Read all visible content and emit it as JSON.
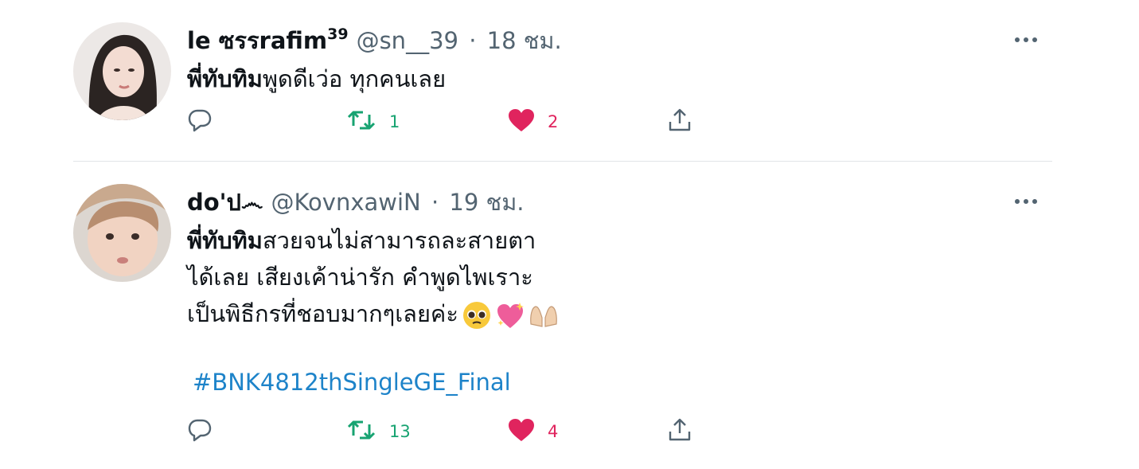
{
  "tweets": [
    {
      "display_name": "le ซรรrafim",
      "name_superscript": "39",
      "handle": "@sn__39",
      "separator": "·",
      "time": "18 ชม.",
      "text_bold": "พี่ทับทิม",
      "text_rest": "พูดดีเว่อ ทุกคนเลย",
      "hashtag": "",
      "replies": "",
      "retweets": "1",
      "likes": "2"
    },
    {
      "display_name": "do'ป෴",
      "name_superscript": "",
      "handle": "@KovnxawiN",
      "separator": "·",
      "time": "19 ชม.",
      "text_bold": "พี่ทับทิม",
      "text_rest": "สวยจนไม่สามารถละสายตา\nได้เลย เสียงเค้าน่ารัก คำพูดไพเราะ\nเป็นพิธีกรที่ชอบมากๆเลยค่ะ",
      "emojis": [
        "pleading-face-emoji",
        "sparkling-heart-emoji",
        "palms-up-emoji"
      ],
      "hashtag": "#BNK4812thSingleGE_Final",
      "replies": "",
      "retweets": "13",
      "likes": "4"
    }
  ],
  "colors": {
    "retweet": "#17a371",
    "like": "#e0245e",
    "hashtag": "#1d83c9",
    "secondary_text": "#536471",
    "divider": "#e1e5e8"
  }
}
